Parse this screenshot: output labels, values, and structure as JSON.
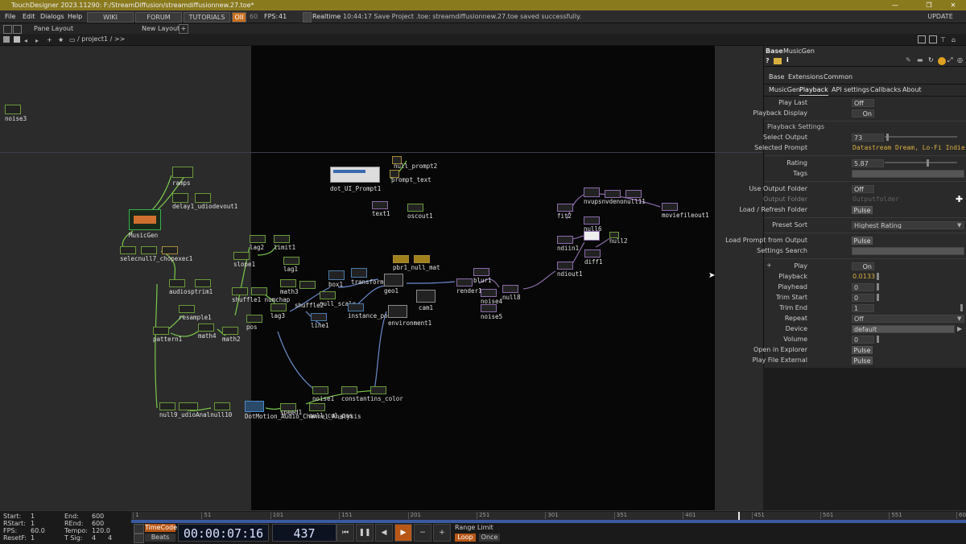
{
  "window": {
    "title": "TouchDesigner 2023.11290: F:/StreamDiffusion/streamdiffusionnew.27.toe*",
    "minimize": "—",
    "maximize": "❐",
    "close": "✕"
  },
  "menubar": {
    "file": "File",
    "edit": "Edit",
    "dialogs": "Dialogs",
    "help": "Help",
    "wiki": "WIKI",
    "forum": "FORUM",
    "tutorials": "TUTORIALS",
    "oii": "OII",
    "sixty": "60",
    "fps_label": "FPS:",
    "fps_value": "41",
    "realtime": "Realtime",
    "status": "10:44:17 Save Project .toe: streamdiffusionnew.27.toe saved successfully.",
    "update": "UPDATE"
  },
  "pane_bar": {
    "pane_layout": "Pane Layout",
    "new_layout": "New Layout",
    "add": "+"
  },
  "path_bar": {
    "path": "/ project1 / >>"
  },
  "nodes": [
    {
      "id": "noise3",
      "label": "noise3"
    },
    {
      "id": "ramps",
      "label": "ramps"
    },
    {
      "id": "delay1",
      "label": "delay1_udiodevout1"
    },
    {
      "id": "musicgen",
      "label": "MusicGen"
    },
    {
      "id": "select1",
      "label": "selecnull7_chopexec1"
    },
    {
      "id": "audiosptrum1",
      "label": "audiosptrim1"
    },
    {
      "id": "resample1",
      "label": "resample1"
    },
    {
      "id": "pattern1",
      "label": "pattern1"
    },
    {
      "id": "math4",
      "label": "math4"
    },
    {
      "id": "math2",
      "label": "math2"
    },
    {
      "id": "pos",
      "label": "pos"
    },
    {
      "id": "lag2",
      "label": "lag2"
    },
    {
      "id": "limit1",
      "label": "limit1"
    },
    {
      "id": "lag1",
      "label": "lag1"
    },
    {
      "id": "slope1",
      "label": "slope1"
    },
    {
      "id": "math3",
      "label": "math3"
    },
    {
      "id": "shuffle1",
      "label": "shuffle1 numchap"
    },
    {
      "id": "lag3",
      "label": "lag3"
    },
    {
      "id": "shuffle2",
      "label": "shuffle2"
    },
    {
      "id": "null_scale",
      "label": "null_scale"
    },
    {
      "id": "line1",
      "label": "line1"
    },
    {
      "id": "box1",
      "label": "box1"
    },
    {
      "id": "transform",
      "label": "transform"
    },
    {
      "id": "instance_pos",
      "label": "instance_pos"
    },
    {
      "id": "geo1",
      "label": "geo1"
    },
    {
      "id": "pbr1",
      "label": "pbr1_null_mat"
    },
    {
      "id": "cam1",
      "label": "cam1"
    },
    {
      "id": "environment1",
      "label": "environment1"
    },
    {
      "id": "dot_ui",
      "label": "dot_UI_Prompt1"
    },
    {
      "id": "null_prompt2",
      "label": "null_prompt2"
    },
    {
      "id": "prompt_text",
      "label": "prompt_text"
    },
    {
      "id": "text1",
      "label": "text1"
    },
    {
      "id": "oscout1",
      "label": "oscout1"
    },
    {
      "id": "render1",
      "label": "render1"
    },
    {
      "id": "blur1",
      "label": "blur1"
    },
    {
      "id": "noise4",
      "label": "noise4"
    },
    {
      "id": "null8",
      "label": "null8"
    },
    {
      "id": "noise5",
      "label": "noise5"
    },
    {
      "id": "fit2",
      "label": "fit2"
    },
    {
      "id": "nvups",
      "label": "nvupsnvdenonull11"
    },
    {
      "id": "moviefileout1",
      "label": "moviefileout1"
    },
    {
      "id": "null6",
      "label": "null6"
    },
    {
      "id": "null2",
      "label": "null2"
    },
    {
      "id": "ndiin1",
      "label": "ndiin1"
    },
    {
      "id": "diff1",
      "label": "diff1"
    },
    {
      "id": "ndiout1",
      "label": "ndiout1"
    },
    {
      "id": "null9",
      "label": "null9_udioAnalnull10"
    },
    {
      "id": "dotmotion",
      "label": "DotMotion_Audio_Channel_Analysis"
    },
    {
      "id": "speed1",
      "label": "speed1"
    },
    {
      "id": "null_col",
      "label": "null_col_pos"
    },
    {
      "id": "noise1",
      "label": "noise1"
    },
    {
      "id": "constant",
      "label": "constantins_color"
    }
  ],
  "params": {
    "header_type": "Base",
    "header_name": "MusicGen",
    "page_tabs": [
      "Base",
      "Extensions",
      "Common"
    ],
    "sub_tabs": [
      "MusicGen",
      "Playback",
      "API settings",
      "Callbacks",
      "About"
    ],
    "play_last": {
      "label": "Play Last",
      "value": "Off"
    },
    "playback_display": {
      "label": "Playback Display",
      "value": "On"
    },
    "playback_settings": "Playback Settings",
    "select_output": {
      "label": "Select Output",
      "value": "73"
    },
    "selected_prompt": {
      "label": "Selected Prompt",
      "value": "Datastream Dream, Lo-Fi Indie,"
    },
    "rating": {
      "label": "Rating",
      "value": "5.87"
    },
    "tags": {
      "label": "Tags",
      "value": ""
    },
    "use_output_folder": {
      "label": "Use Output Folder",
      "value": "Off"
    },
    "output_folder": {
      "label": "Output Folder",
      "value": "Outputfolder"
    },
    "load_refresh": {
      "label": "Load / Refresh Folder",
      "value": "Pulse"
    },
    "preset_sort": {
      "label": "Preset Sort",
      "value": "Highest Rating"
    },
    "load_prompt": {
      "label": "Load Prompt from Output",
      "value": "Pulse"
    },
    "settings_search": {
      "label": "Settings Search",
      "value": ""
    },
    "play": {
      "label": "Play",
      "value": "On"
    },
    "playback": {
      "label": "Playback",
      "value": "0.0133"
    },
    "playhead": {
      "label": "Playhead",
      "value": "0"
    },
    "trim_start": {
      "label": "Trim Start",
      "value": "0"
    },
    "trim_end": {
      "label": "Trim End",
      "value": "1"
    },
    "repeat": {
      "label": "Repeat",
      "value": "Off"
    },
    "device": {
      "label": "Device",
      "value": "default"
    },
    "volume": {
      "label": "Volume",
      "value": "0"
    },
    "open_explorer": {
      "label": "Open in Explorer",
      "value": "Pulse"
    },
    "play_file_external": {
      "label": "Play File External",
      "value": "Pulse"
    }
  },
  "timeline": {
    "start_label": "Start:",
    "start": "1",
    "rstart_label": "RStart:",
    "rstart": "1",
    "fps_label": "FPS:",
    "fps": "60.0",
    "resetf_label": "ResetF:",
    "resetf": "1",
    "end_label": "End:",
    "end": "600",
    "rend_label": "REnd:",
    "rend": "600",
    "tempo_label": "Tempo:",
    "tempo": "120.0",
    "tsig_label": "T Sig:",
    "tsig_a": "4",
    "tsig_b": "4",
    "timecode": "TimeCode",
    "beats": "Beats",
    "time": "00:00:07:16",
    "frame": "437",
    "range_limit": "Range Limit",
    "loop": "Loop",
    "once": "Once",
    "ruler_ticks": [
      "1",
      "51",
      "101",
      "151",
      "201",
      "251",
      "301",
      "351",
      "401",
      "451",
      "501",
      "551",
      "600"
    ]
  }
}
